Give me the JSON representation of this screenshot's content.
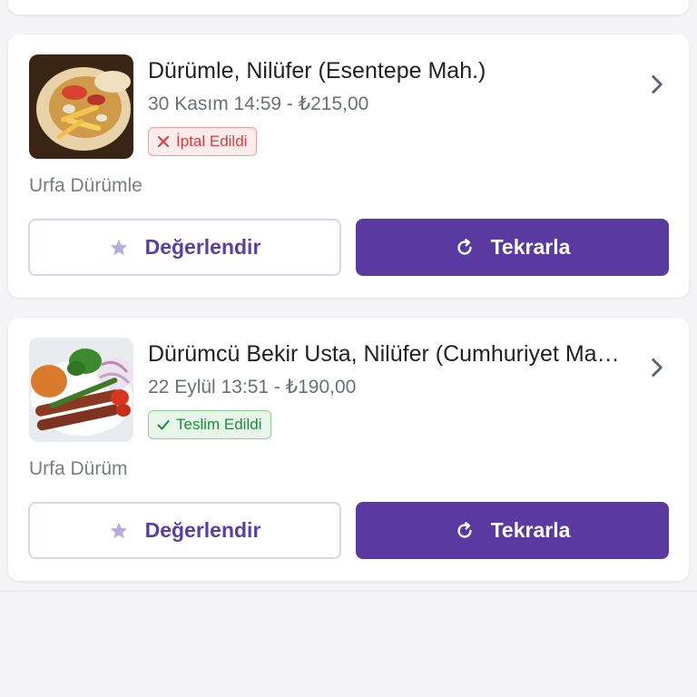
{
  "colors": {
    "accent": "#5a3aa0",
    "cancel": "#d63c3c",
    "success": "#1f8a3b"
  },
  "orders": [
    {
      "restaurant": "Dürümle, Nilüfer (Esentepe Mah.)",
      "meta": "30 Kasım 14:59 - ₺215,00",
      "status": "İptal Edildi",
      "status_type": "cancelled",
      "status_icon": "x-icon",
      "items": "Urfa Dürümle",
      "rate_label": "Değerlendir",
      "repeat_label": "Tekrarla"
    },
    {
      "restaurant": "Dürümcü Bekir Usta, Nilüfer (Cumhuriyet Mah.)",
      "meta": "22 Eylül 13:51 - ₺190,00",
      "status": "Teslim Edildi",
      "status_type": "delivered",
      "status_icon": "check-icon",
      "items": "Urfa Dürüm",
      "rate_label": "Değerlendir",
      "repeat_label": "Tekrarla"
    }
  ]
}
